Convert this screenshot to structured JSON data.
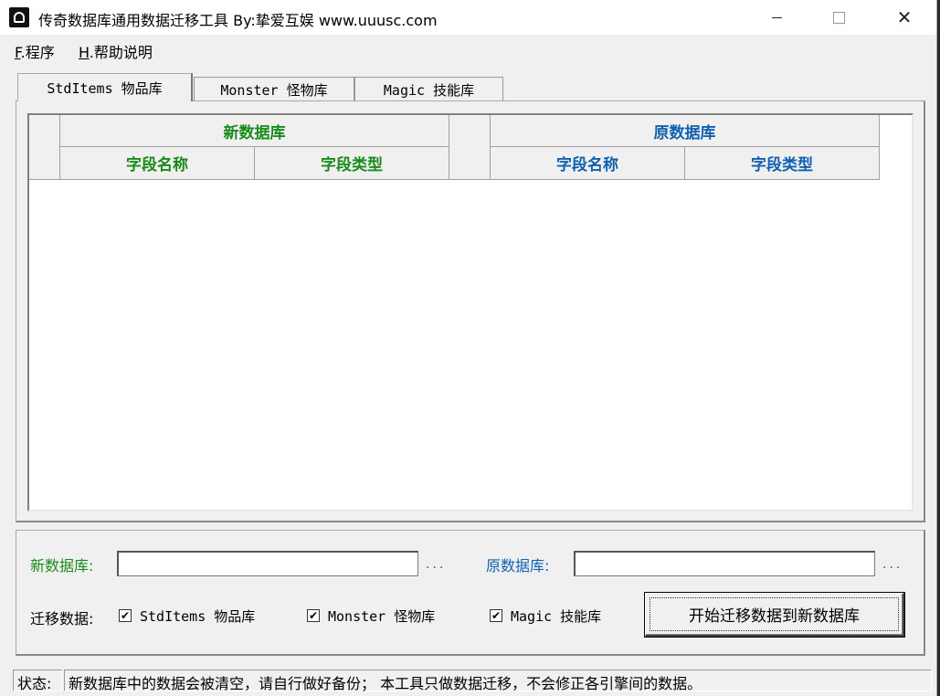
{
  "window": {
    "title": "传奇数据库通用数据迁移工具 By:挚爱互娱 www.uuusc.com"
  },
  "menu": [
    {
      "key": "F",
      "label": ".程序"
    },
    {
      "key": "H",
      "label": ".帮助说明"
    }
  ],
  "tabs": [
    "StdItems 物品库",
    "Monster 怪物库",
    "Magic 技能库"
  ],
  "grid": {
    "new_db_header": "新数据库",
    "old_db_header": "原数据库",
    "new_columns": [
      "字段名称",
      "字段类型"
    ],
    "old_columns": [
      "字段名称",
      "字段类型"
    ]
  },
  "form": {
    "new_db_label": "新数据库:",
    "old_db_label": "原数据库:",
    "new_db_value": "",
    "old_db_value": "",
    "browse_dots": "...",
    "migrate_label": "迁移数据:",
    "checkboxes": [
      {
        "label": "StdItems 物品库",
        "checked": true
      },
      {
        "label": "Monster 怪物库",
        "checked": true
      },
      {
        "label": "Magic 技能库",
        "checked": true
      }
    ],
    "start_button": "开始迁移数据到新数据库"
  },
  "status": {
    "label": "状态:",
    "message": "新数据库中的数据会被清空，请自行做好备份；    本工具只做数据迁移，不会修正各引擎间的数据。"
  },
  "colors": {
    "new_db": "#1a8a1a",
    "old_db": "#1060b0"
  }
}
